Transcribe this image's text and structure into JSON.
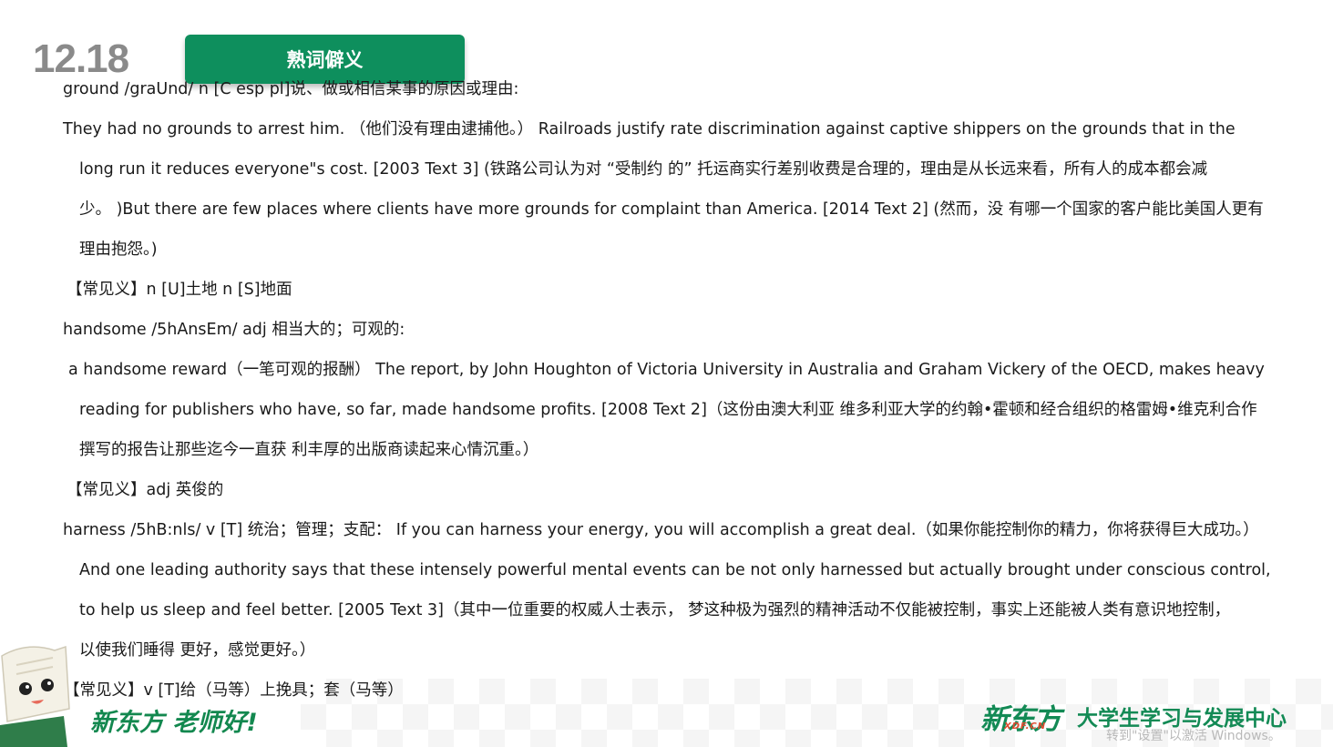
{
  "header": {
    "date": "12.18",
    "section_title": "熟词僻义"
  },
  "lines": [
    "ground /graUnd/ n [C esp pl]说、做或相信某事的原因或理由:",
    "They had no grounds to arrest him. （他们没有理由逮捕他。） Railroads justify rate discrimination against captive shippers on the grounds that in the",
    "long run it reduces everyone\"s cost. [2003 Text 3] (铁路公司认为对 “受制约 的” 托运商实行差别收费是合理的，理由是从长远来看，所有人的成本都会减",
    "少。 )But there are few places where clients have more grounds for complaint than America. [2014 Text 2] (然而，没 有哪一个国家的客户能比美国人更有",
    "理由抱怨。)",
    "【常见义】n [U]土地 n [S]地面",
    "handsome /5hAnsEm/ adj 相当大的；可观的:",
    "a handsome reward（一笔可观的报酬） The report, by John Houghton of Victoria University in Australia and Graham Vickery of the OECD, makes heavy",
    "reading for publishers who have, so far, made handsome profits. [2008 Text 2]（这份由澳大利亚 维多利亚大学的约翰•霍顿和经合组织的格雷姆•维克利合作",
    "撰写的报告让那些迄今一直获 利丰厚的出版商读起来心情沉重。）",
    "【常见义】adj 英俊的",
    "harness /5hB:nls/ v [T] 统治；管理；支配： If you can harness your energy, you will accomplish a great deal.（如果你能控制你的精力，你将获得巨大成功。）",
    "And one leading authority says that these intensely powerful mental events can be not only harnessed but actually brought under conscious control,",
    "to help us sleep and feel better. [2005 Text 3]（其中一位重要的权威人士表示， 梦这种极为强烈的精神活动不仅能被控制，事实上还能被人类有意识地控制，",
    "以使我们睡得 更好，感觉更好。）",
    "【常见义】v [T]给（马等）上挽具；套（马等）"
  ],
  "footer": {
    "slogan": "新东方 老师好!",
    "logo_cn": "新东方",
    "logo_en": "XDF.CN",
    "center_name": "大学生学习与发展中心",
    "watermark": "转到\"设置\"以激活 Windows。"
  },
  "colors": {
    "brand_green": "#0e8f5d",
    "date_gray": "#8a8a8a",
    "logo_red": "#e04a2f"
  }
}
